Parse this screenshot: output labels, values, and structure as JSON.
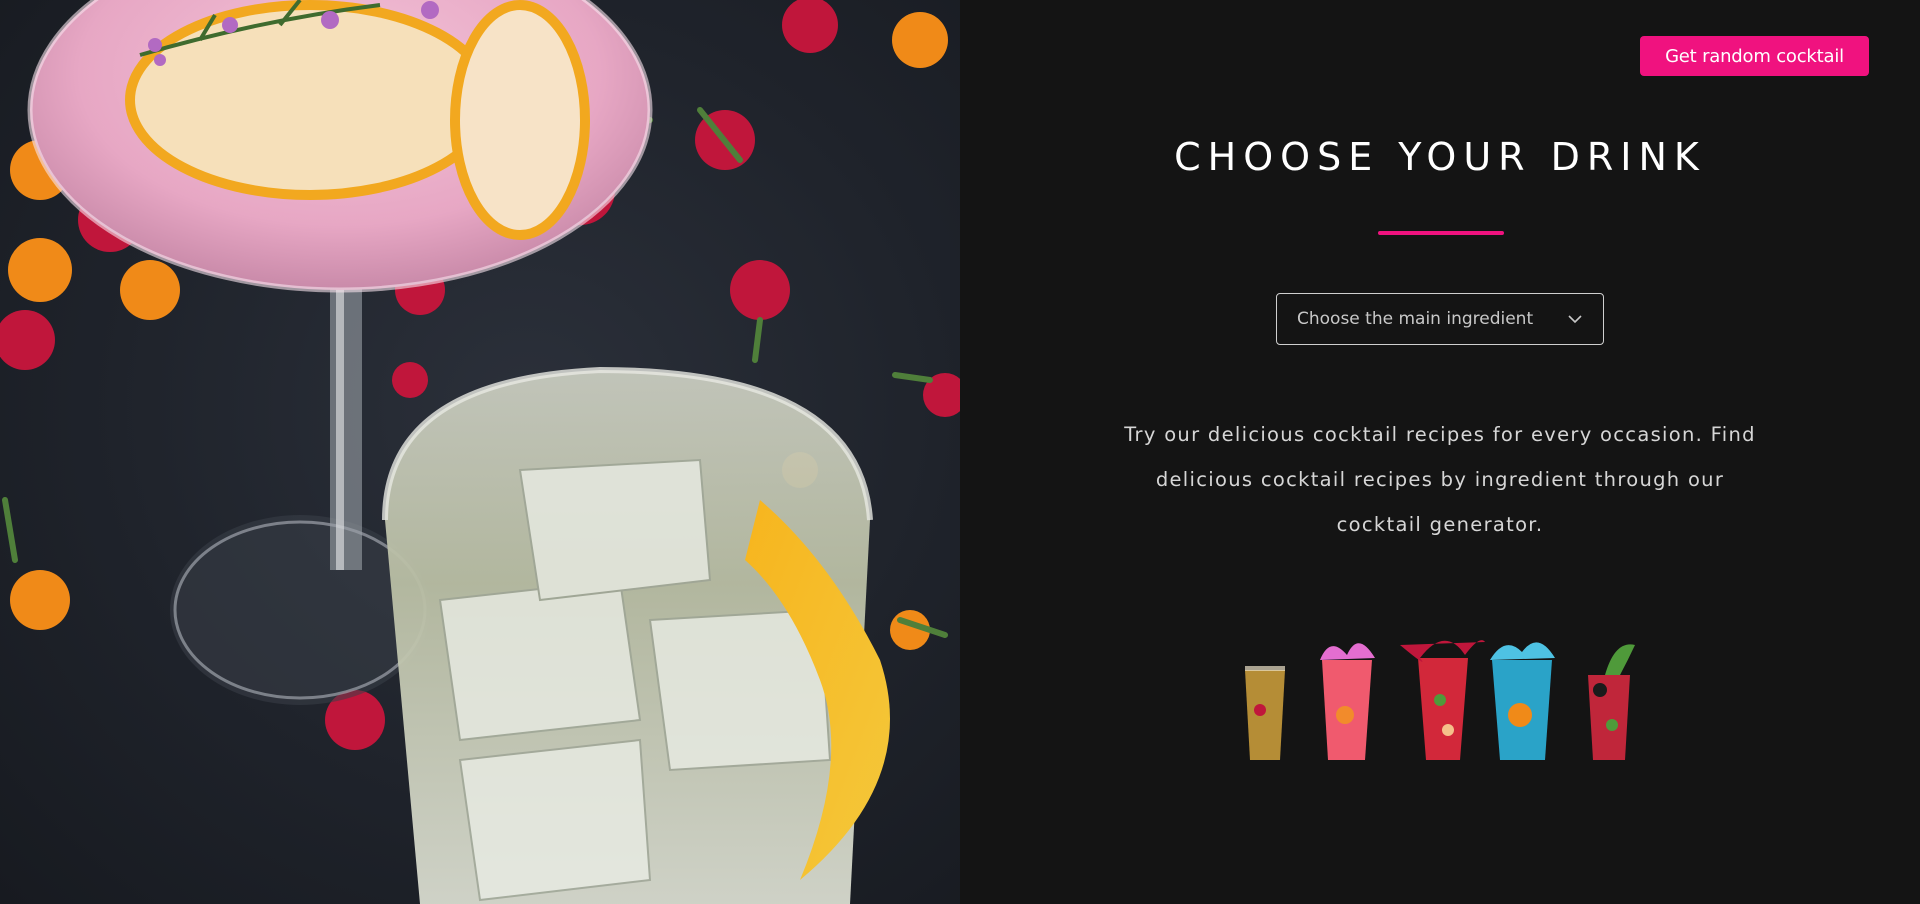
{
  "header": {
    "random_button_label": "Get random cocktail"
  },
  "main": {
    "title": "CHOOSE YOUR DRINK",
    "ingredient_select": {
      "selected_label": "Choose the main ingredient"
    },
    "intro_text": "Try our delicious cocktail recipes for every occasion. Find delicious cocktail recipes by ingredient through our cocktail generator."
  },
  "icons": {
    "chevron": "chevron-down-icon"
  },
  "colors": {
    "accent": "#f0127f",
    "background": "#141414",
    "text": "#ffffff",
    "muted_text": "#d6d6d6"
  }
}
